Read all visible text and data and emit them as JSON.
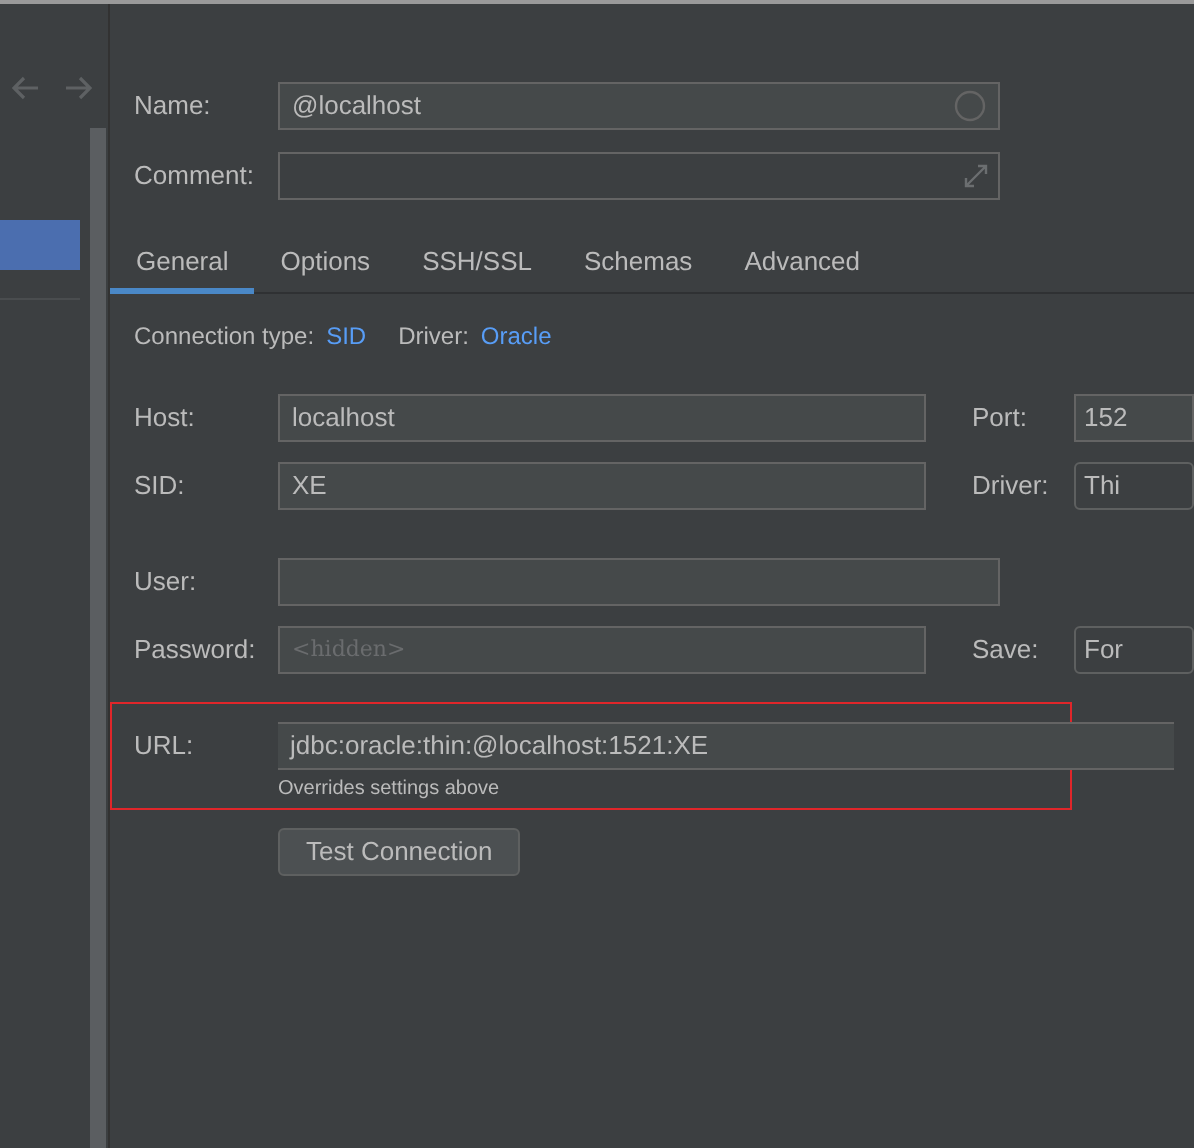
{
  "name_field": {
    "label": "Name:",
    "value": "@localhost"
  },
  "comment_field": {
    "label": "Comment:"
  },
  "tabs": [
    {
      "label": "General",
      "selected": true
    },
    {
      "label": "Options",
      "selected": false
    },
    {
      "label": "SSH/SSL",
      "selected": false
    },
    {
      "label": "Schemas",
      "selected": false
    },
    {
      "label": "Advanced",
      "selected": false
    }
  ],
  "connection_info": [
    {
      "label": "Connection type:",
      "value": "SID"
    },
    {
      "label": "Driver:",
      "value": "Oracle"
    }
  ],
  "rows": [
    {
      "label": "Host:",
      "value": "localhost",
      "side": {
        "label": "Port:",
        "value": "152",
        "kind": "text"
      }
    },
    {
      "label": "SID:",
      "value": "XE",
      "side": {
        "label": "Driver:",
        "value": "Thi",
        "kind": "select"
      }
    },
    {
      "label": "User:",
      "value": ""
    },
    {
      "label": "Password:",
      "placeholder": "<hidden>",
      "side": {
        "label": "Save:",
        "value": "For",
        "kind": "select"
      }
    }
  ],
  "url": {
    "label": "URL:",
    "value": "jdbc:oracle:thin:@localhost:1521:XE",
    "hint": "Overrides settings above",
    "highlighted": true
  },
  "test_button": "Test Connection"
}
